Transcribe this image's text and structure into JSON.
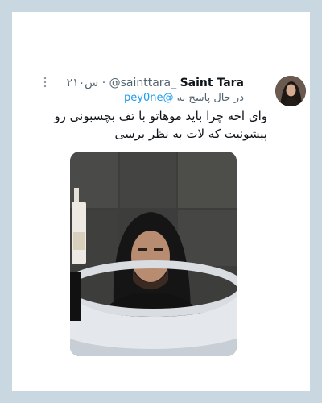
{
  "tweet": {
    "author_name": "Saint Tara",
    "handle": "@sainttara_",
    "separator": "·",
    "time": "۲۱۰س",
    "reply_prefix": "در حال پاسخ به",
    "reply_to": "@pey0ne",
    "text": "وای اخه چرا باید موهاتو با تف بچسبونی رو پیشونیت که لات به نظر برسی",
    "more_icon": "more-vertical-icon",
    "avatar_icon": "user-avatar",
    "media_icon": "photo-man-in-bathtub"
  },
  "colors": {
    "background": "#c9d8e0",
    "card": "#ffffff",
    "name": "#0f1419",
    "secondary": "#536471",
    "link": "#1d9bf0"
  }
}
